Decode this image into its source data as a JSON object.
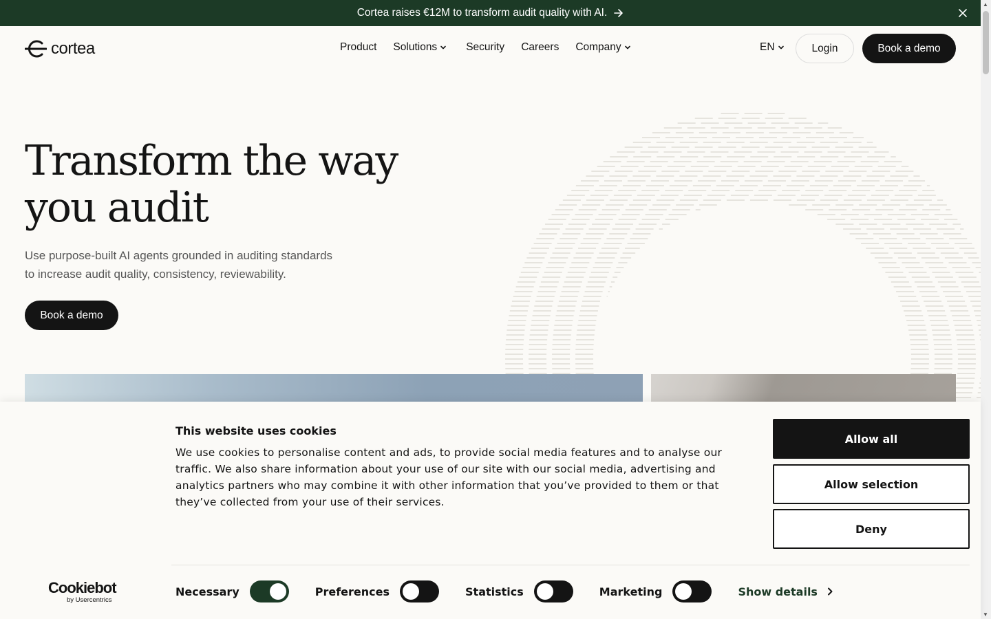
{
  "announcement": {
    "text": "Cortea raises €12M to transform audit quality with AI.",
    "arrow_icon": "arrow-right-icon",
    "close_icon": "close-icon"
  },
  "header": {
    "logo_text": "cortea",
    "nav": [
      {
        "label": "Product",
        "has_dropdown": false
      },
      {
        "label": "Solutions",
        "has_dropdown": true
      },
      {
        "label": "Security",
        "has_dropdown": false
      },
      {
        "label": "Careers",
        "has_dropdown": false
      },
      {
        "label": "Company",
        "has_dropdown": true
      }
    ],
    "language": "EN",
    "login_label": "Login",
    "book_demo_label": "Book a demo"
  },
  "hero": {
    "title_line1": "Transform the way",
    "title_line2": "you audit",
    "subtitle_line1": "Use purpose-built AI agents grounded in auditing standards",
    "subtitle_line2": "to increase audit quality, consistency, reviewability.",
    "cta_label": "Book a demo"
  },
  "cookie": {
    "title": "This website uses cookies",
    "body": "We use cookies to personalise content and ads, to provide social media features and to analyse our traffic. We also share information about your use of our site with our social media, advertising and analytics partners who may combine it with other information that you’ve provided to them or that they’ve collected from your use of their services.",
    "allow_all": "Allow all",
    "allow_selection": "Allow selection",
    "deny": "Deny",
    "brand_main": "Cookiebot",
    "brand_sub": "by Usercentrics",
    "toggles": [
      {
        "label": "Necessary",
        "on": true
      },
      {
        "label": "Preferences",
        "on": false
      },
      {
        "label": "Statistics",
        "on": false
      },
      {
        "label": "Marketing",
        "on": false
      }
    ],
    "show_details": "Show details"
  },
  "colors": {
    "brand_green": "#1c3a26",
    "dark": "#141414",
    "background": "#fbfaf7"
  }
}
